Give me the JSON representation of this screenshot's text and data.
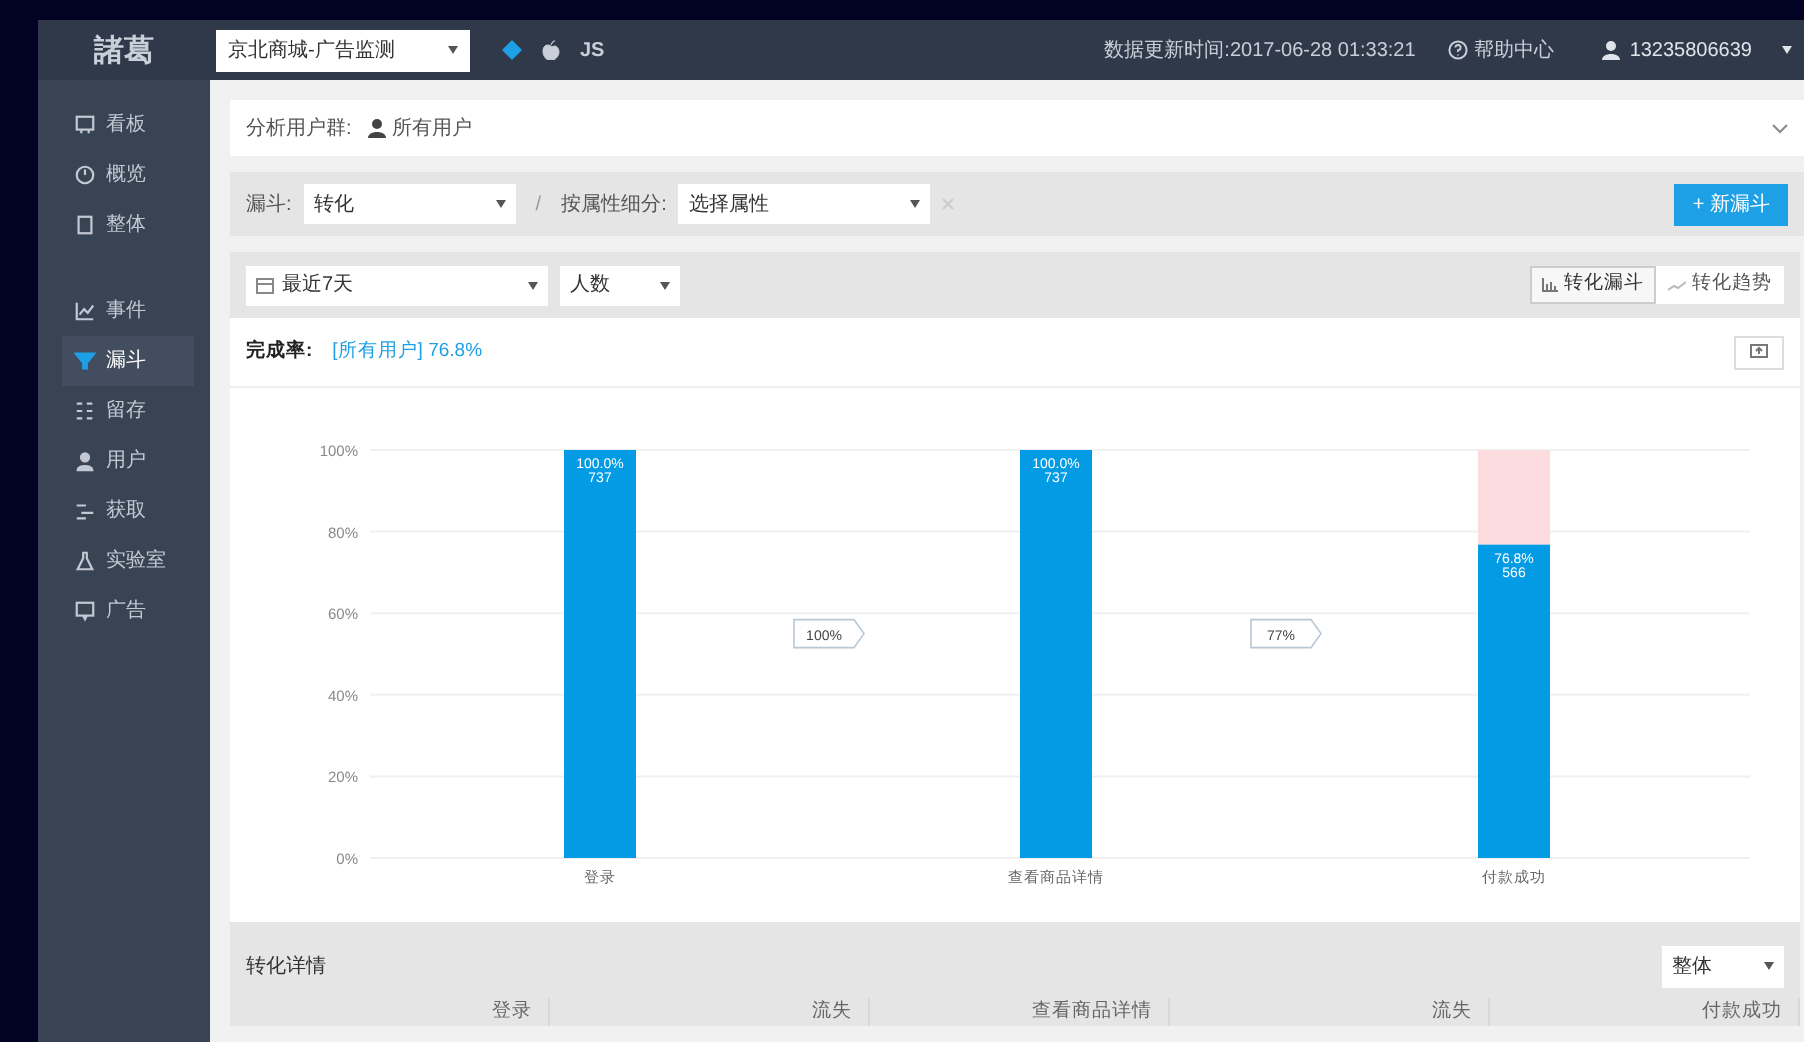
{
  "logo": "諸葛",
  "project_select": {
    "value": "京北商城-广告监测"
  },
  "platforms": [
    {
      "kind": "web",
      "selected": true
    },
    {
      "kind": "ios",
      "selected": false
    },
    {
      "kind": "js",
      "label": "JS",
      "selected": false
    }
  ],
  "header": {
    "update_time": "数据更新时间:2017-06-28 01:33:21",
    "help": "帮助中心",
    "user": "13235806639"
  },
  "sidebar": {
    "items": [
      {
        "label": "看板",
        "kind": "board",
        "selected": false
      },
      {
        "label": "概览",
        "kind": "gauge",
        "selected": false
      },
      {
        "label": "整体",
        "kind": "tablet",
        "selected": false
      },
      {
        "label": "事件",
        "kind": "chart",
        "selected": false
      },
      {
        "label": "漏斗",
        "kind": "funnel",
        "selected": true
      },
      {
        "label": "留存",
        "kind": "grid",
        "selected": false
      },
      {
        "label": "用户",
        "kind": "user",
        "selected": false
      },
      {
        "label": "获取",
        "kind": "acquire",
        "selected": false
      },
      {
        "label": "实验室",
        "kind": "flask",
        "selected": false
      },
      {
        "label": "广告",
        "kind": "ad",
        "selected": false
      }
    ]
  },
  "segment": {
    "label": "分析用户群:",
    "value": "所有用户"
  },
  "funnel_bar": {
    "funnel_label": "漏斗:",
    "funnel_value": "转化",
    "separator": "/",
    "split_label": "按属性细分:",
    "split_value": "选择属性",
    "new_button": "+ 新漏斗"
  },
  "filters": {
    "date": "最近7天",
    "metric": "人数",
    "view_tabs": [
      {
        "label": "转化漏斗",
        "kind": "bars",
        "selected": true
      },
      {
        "label": "转化趋势",
        "kind": "line",
        "selected": false
      }
    ]
  },
  "completion": {
    "label": "完成率:",
    "value": "[所有用户] 76.8%"
  },
  "chart": {
    "chart_data": {
      "type": "bar",
      "stacked": true,
      "grid": true,
      "categories": [
        "登录",
        "查看商品详情",
        "付款成功"
      ],
      "series": [
        {
          "color": "#049be5",
          "values": [
            100,
            100,
            76.8
          ]
        },
        {
          "color": "#fcdcdf",
          "values": [
            0,
            0,
            23.2
          ]
        }
      ],
      "ylim": [
        0,
        100
      ],
      "yticks": [
        {
          "value": 0,
          "label": "0%"
        },
        {
          "value": 20,
          "label": "20%"
        },
        {
          "value": 40,
          "label": "40%"
        },
        {
          "value": 60,
          "label": "60%"
        },
        {
          "value": 80,
          "label": "80%"
        },
        {
          "value": 100,
          "label": "100%"
        }
      ],
      "value_labels": [
        "100.0%",
        "100.0%",
        "76.8%"
      ],
      "annotations": [
        {
          "x": "登录",
          "y": 100,
          "text": "737"
        },
        {
          "x": "查看商品详情",
          "y": 100,
          "text": "737"
        },
        {
          "x": "付款成功",
          "y": 76.8,
          "text": "566"
        }
      ]
    },
    "step_rates": [
      "100%",
      "77%"
    ]
  },
  "details": {
    "title": "转化详情",
    "select": "整体",
    "columns": [
      "登录",
      "流失",
      "查看商品详情",
      "流失",
      "付款成功"
    ]
  }
}
